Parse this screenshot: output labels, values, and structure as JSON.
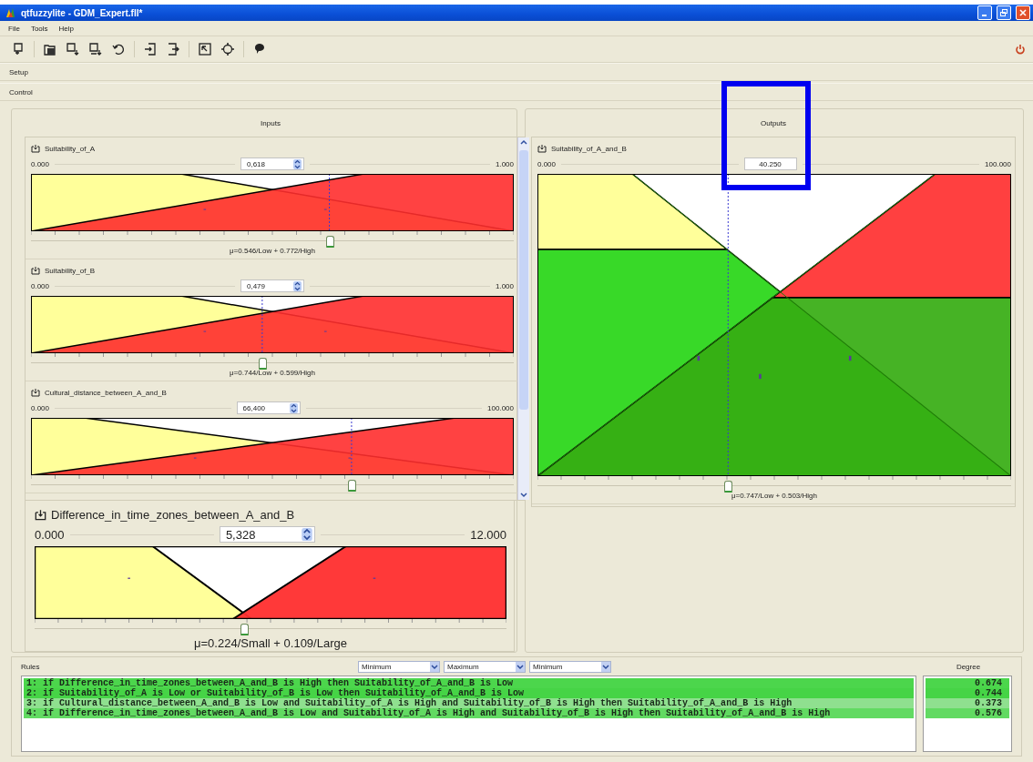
{
  "window": {
    "title": "qtfuzzylite - GDM_Expert.fll*"
  },
  "menu": [
    "File",
    "Tools",
    "Help"
  ],
  "sections": [
    "Setup",
    "Control"
  ],
  "inputs": {
    "title": "Inputs",
    "variables": [
      {
        "name": "Suitability_of_A",
        "min": "0.000",
        "max": "1.000",
        "value": "0,618",
        "level": 0.618,
        "kind": "narrow-shoulders",
        "degrees": "μ=0.546/Low + 0.772/High"
      },
      {
        "name": "Suitability_of_B",
        "min": "0.000",
        "max": "1.000",
        "value": "0,479",
        "level": 0.479,
        "kind": "narrow-shoulders",
        "degrees": "μ=0.744/Low + 0.599/High"
      },
      {
        "name": "Cultural_distance_between_A_and_B",
        "min": "0.000",
        "max": "100.000",
        "value": "66,400",
        "level": 0.664,
        "kind": "wide-shoulders"
      }
    ],
    "detached": {
      "name": "Difference_in_time_zones_between_A_and_B",
      "min": "0.000",
      "max": "12.000",
      "value": "5,328",
      "level": 0.444,
      "kind": "trapezoids",
      "degrees": "μ=0.224/Small + 0.109/Large"
    }
  },
  "outputs": {
    "title": "Outputs",
    "variables": [
      {
        "name": "Suitability_of_A_and_B",
        "min": "0.000",
        "max": "100.000",
        "value": "40.250",
        "level": 0.4025,
        "kind": "clipped-ramps",
        "degrees": "μ=0.747/Low + 0.503/High"
      }
    ]
  },
  "rules": {
    "title": "Rules",
    "operators": [
      "Minimum",
      "Maximum",
      "Minimum"
    ],
    "degree_title": "Degree",
    "items": [
      {
        "text": "1: if Difference_in_time_zones_between_A_and_B is High then Suitability_of_A_and_B is Low",
        "degree": "0.674",
        "color": "#4cd64c"
      },
      {
        "text": "2: if Suitability_of_A is Low or Suitability_of_B is Low then Suitability_of_A_and_B is Low",
        "degree": "0.744",
        "color": "#46d446"
      },
      {
        "text": "3: if Cultural_distance_between_A_and_B is Low and Suitability_of_A is High and Suitability_of_B is High then Suitability_of_A_and_B is High",
        "degree": "0.373",
        "color": "#8fe08f"
      },
      {
        "text": "4: if Difference_in_time_zones_between_A_and_B is Low and Suitability_of_A is High and Suitability_of_B is High then Suitability_of_A_and_B is High",
        "degree": "0.576",
        "color": "#62da62"
      }
    ]
  },
  "annotation": {
    "kind": "box"
  }
}
